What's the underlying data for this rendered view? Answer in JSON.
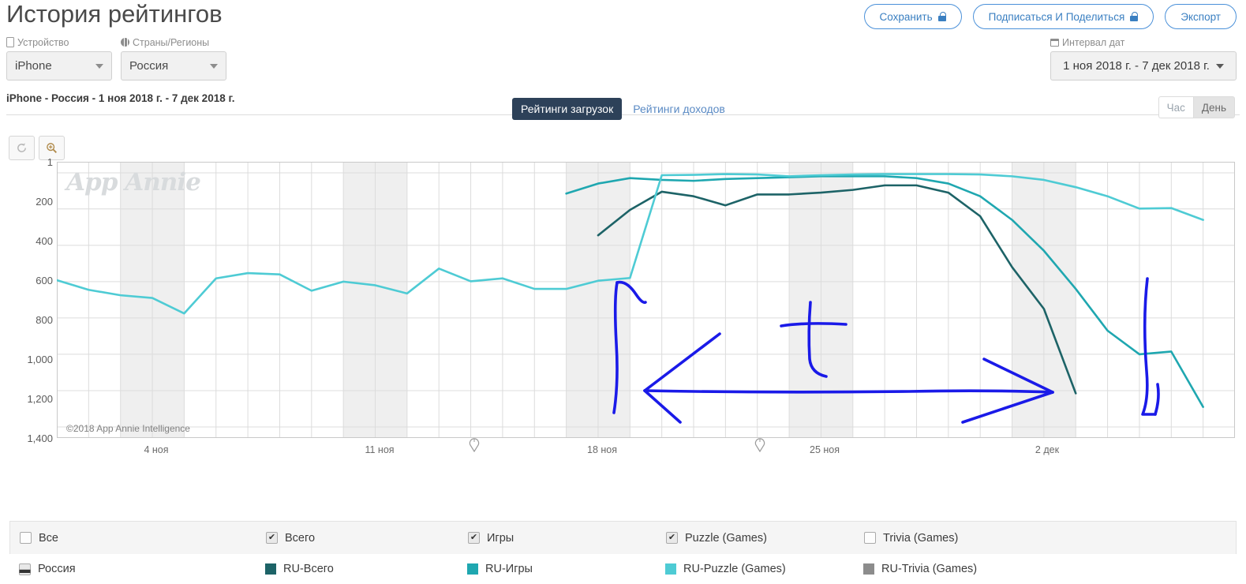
{
  "header": {
    "title": "История рейтингов",
    "subtitle": "iPhone - Россия - 1 ноя 2018 г. - 7 дек 2018 г.",
    "buttons": [
      {
        "label": "Сохранить",
        "icon": "lock-icon",
        "locked": true
      },
      {
        "label": "Подписаться И Поделиться",
        "icon": "lock-icon",
        "locked": true
      },
      {
        "label": "Экспорт",
        "icon": "",
        "locked": false
      }
    ],
    "device": {
      "label": "Устройство",
      "icon": "device-icon",
      "value": "iPhone"
    },
    "country": {
      "label": "Страны/Регионы",
      "icon": "globe-icon",
      "value": "Россия"
    },
    "date_range": {
      "label": "Интервал дат",
      "icon": "calendar-icon",
      "value": "1 ноя 2018 г. - 7 дек 2018 г."
    }
  },
  "tabs": {
    "active": "Рейтинги загрузок",
    "inactive": "Рейтинги доходов",
    "granularity": {
      "hour": "Час",
      "day": "День",
      "selected": "День"
    }
  },
  "chart_controls": {
    "reset_icon": "reset-icon",
    "zoom_icon": "zoom-in-icon"
  },
  "chart_data": {
    "type": "line",
    "title": "iPhone - Россия - 1 ноя 2018 г. - 7 дек 2018 г.",
    "xlabel": "",
    "ylabel": "",
    "grid": true,
    "legend_position": "bottom",
    "watermark": "App Annie",
    "copyright": "©2018 App Annie Intelligence",
    "ylim": [
      1,
      1400
    ],
    "yticks": [
      "1",
      "200",
      "400",
      "600",
      "800",
      "1,000",
      "1,200",
      "1,400"
    ],
    "ytick_values": [
      1,
      200,
      400,
      600,
      800,
      1000,
      1200,
      1400
    ],
    "y_inverted": true,
    "xticks": [
      "4 ноя",
      "11 ноя",
      "18 ноя",
      "25 ноя",
      "2 дек"
    ],
    "xtick_days": [
      4,
      11,
      18,
      25,
      32
    ],
    "x_start": "1 ноя 2018",
    "x_end": "7 дек 2018",
    "x_days": 37,
    "weekend_bands": [
      [
        2,
        4
      ],
      [
        9,
        11
      ],
      [
        16,
        18
      ],
      [
        23,
        25
      ],
      [
        30,
        32
      ]
    ],
    "series": [
      {
        "name": "RU-Всего",
        "color": "#1d6367",
        "x": [
          17,
          18,
          19,
          20,
          21,
          22,
          23,
          24,
          25,
          26,
          27,
          28,
          29,
          30,
          31,
          32
        ],
        "values": [
          345,
          205,
          105,
          130,
          180,
          120,
          120,
          110,
          95,
          70,
          70,
          110,
          240,
          520,
          750,
          1215
        ]
      },
      {
        "name": "RU-Игры",
        "color": "#1fa7b0",
        "x": [
          16,
          17,
          18,
          19,
          20,
          21,
          22,
          23,
          24,
          25,
          26,
          27,
          28,
          29,
          30,
          31,
          32,
          33,
          34,
          35,
          36
        ],
        "values": [
          115,
          60,
          30,
          40,
          45,
          35,
          30,
          25,
          20,
          20,
          20,
          30,
          60,
          130,
          260,
          430,
          640,
          870,
          1000,
          985,
          1290
        ]
      },
      {
        "name": "RU-Puzzle (Games)",
        "color": "#4ecbd4",
        "x": [
          0,
          1,
          2,
          3,
          4,
          5,
          6,
          7,
          8,
          9,
          10,
          11,
          12,
          13,
          14,
          15,
          16,
          17,
          18,
          19,
          20,
          21,
          22,
          23,
          24,
          25,
          26,
          27,
          28,
          29,
          30,
          31,
          32,
          33,
          34,
          35,
          36
        ],
        "values": [
          592,
          645,
          675,
          690,
          775,
          582,
          553,
          560,
          650,
          600,
          620,
          665,
          528,
          598,
          582,
          640,
          640,
          595,
          580,
          14,
          12,
          8,
          10,
          20,
          14,
          10,
          8,
          8,
          8,
          10,
          20,
          40,
          80,
          130,
          198,
          195,
          260
        ]
      }
    ],
    "annotations": [
      {
        "type": "hand-drawn-arrow",
        "label": "double-headed arrow spanning the high-rank plateau",
        "color": "#1a1ae8"
      },
      {
        "type": "hand-drawn-text",
        "label": "t",
        "color": "#1a1ae8"
      }
    ]
  },
  "legend": {
    "categories": [
      {
        "label": "Все",
        "checked": false,
        "state": "unchecked"
      },
      {
        "label": "Всего",
        "checked": true,
        "state": "checked"
      },
      {
        "label": "Игры",
        "checked": true,
        "state": "checked"
      },
      {
        "label": "Puzzle (Games)",
        "checked": true,
        "state": "checked"
      },
      {
        "label": "Trivia (Games)",
        "checked": false,
        "state": "unchecked"
      }
    ],
    "rows": [
      {
        "label": "Россия",
        "state": "partial",
        "swatch": ""
      },
      {
        "label": "RU-Всего",
        "swatch": "#1d6367"
      },
      {
        "label": "RU-Игры",
        "swatch": "#1fa7b0"
      },
      {
        "label": "RU-Puzzle (Games)",
        "swatch": "#4ecbd4"
      },
      {
        "label": "RU-Trivia (Games)",
        "swatch": "#8c8c8c"
      }
    ]
  },
  "colors": {
    "accent": "#4a90d9",
    "tab_active_bg": "#2d4159",
    "total": "#1d6367",
    "games": "#1fa7b0",
    "puzzle": "#4ecbd4",
    "trivia": "#8c8c8c",
    "annotation": "#1a1ae8"
  }
}
